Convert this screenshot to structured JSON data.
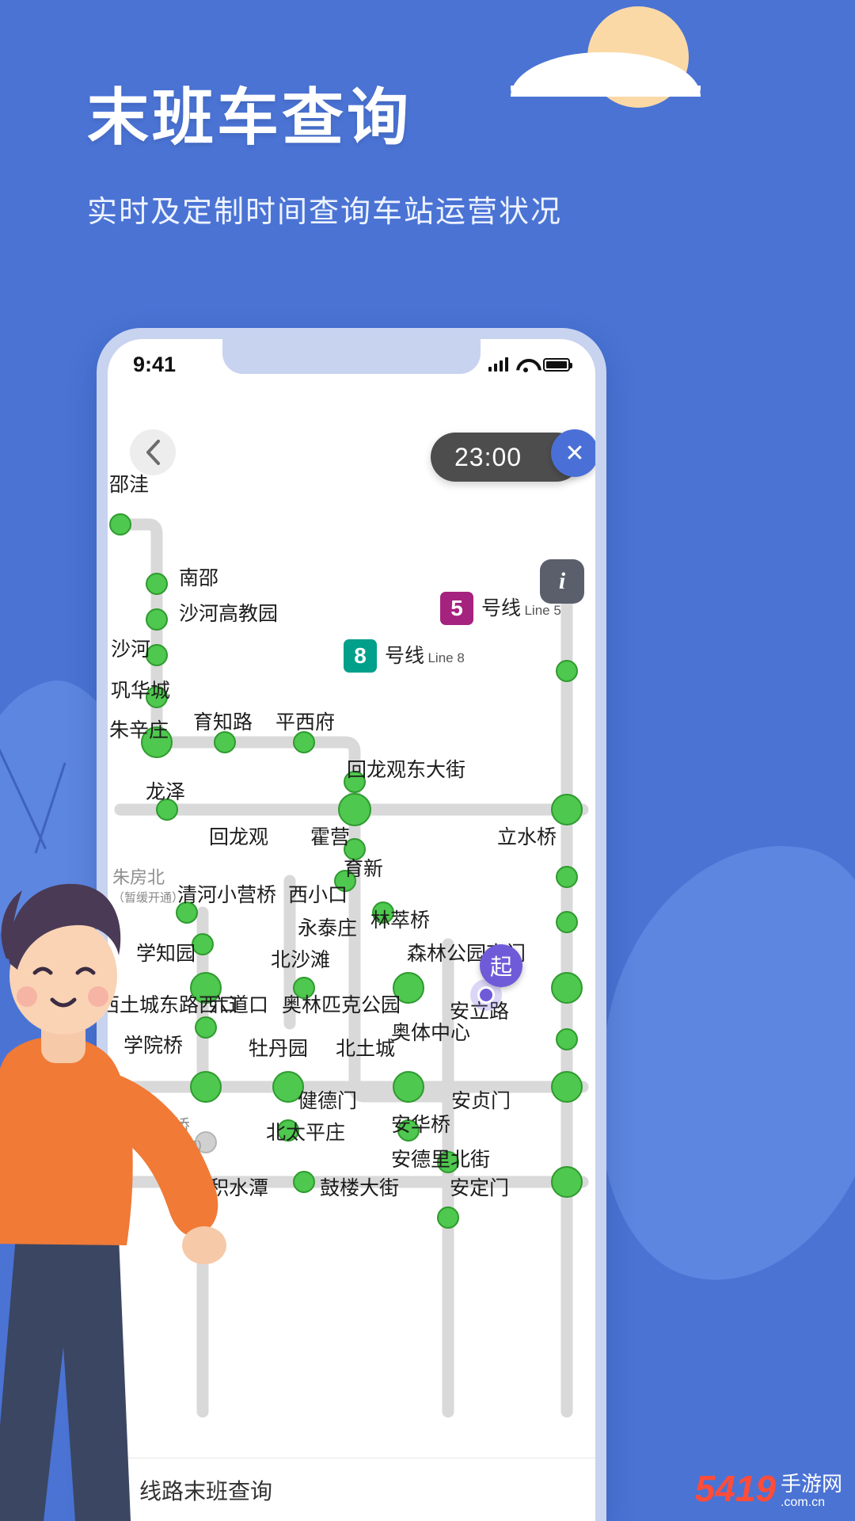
{
  "hero": {
    "title": "末班车查询",
    "subtitle": "实时及定制时间查询车站运营状况"
  },
  "colors": {
    "background": "#4a73d4",
    "accent": "#4a6fd6",
    "station": "#4ec84e",
    "line5": "#a5227f",
    "line8": "#00a08a",
    "chip": "#4d4d4d"
  },
  "phone": {
    "statusbar": {
      "time": "9:41",
      "signal_icon": "signal-bars-icon",
      "wifi_icon": "wifi-icon",
      "battery_icon": "battery-icon"
    },
    "toolbar": {
      "back_icon": "chevron-left-icon",
      "time_chip": "23:00",
      "close_icon": "✕",
      "info_icon": "i"
    },
    "line_badges": [
      {
        "number": "5",
        "cn": "号线",
        "en": "Line 5",
        "color": "#a5227f"
      },
      {
        "number": "8",
        "cn": "号线",
        "en": "Line 8",
        "color": "#00a08a"
      }
    ],
    "start_marker": {
      "label": "起"
    },
    "stations": [
      {
        "name": "邵洼",
        "note": ""
      },
      {
        "name": "南邵",
        "note": ""
      },
      {
        "name": "沙河高教园",
        "note": ""
      },
      {
        "name": "沙河",
        "note": ""
      },
      {
        "name": "巩华城",
        "note": ""
      },
      {
        "name": "朱辛庄",
        "note": ""
      },
      {
        "name": "育知路",
        "note": ""
      },
      {
        "name": "平西府",
        "note": ""
      },
      {
        "name": "回龙观东大街",
        "note": ""
      },
      {
        "name": "龙泽",
        "note": ""
      },
      {
        "name": "回龙观",
        "note": ""
      },
      {
        "name": "霍营",
        "note": ""
      },
      {
        "name": "立水桥",
        "note": ""
      },
      {
        "name": "育新",
        "note": ""
      },
      {
        "name": "朱房北",
        "note": "（暂缓开通）"
      },
      {
        "name": "清河小营桥",
        "note": ""
      },
      {
        "name": "西小口",
        "note": ""
      },
      {
        "name": "林萃桥",
        "note": ""
      },
      {
        "name": "永泰庄",
        "note": ""
      },
      {
        "name": "森林公园南门",
        "note": ""
      },
      {
        "name": "学知园",
        "note": ""
      },
      {
        "name": "北沙滩",
        "note": ""
      },
      {
        "name": "西土城东路西口",
        "note": ""
      },
      {
        "name": "六道口",
        "note": ""
      },
      {
        "name": "奥林匹克公园",
        "note": ""
      },
      {
        "name": "安立路",
        "note": ""
      },
      {
        "name": "学院桥",
        "note": ""
      },
      {
        "name": "牡丹园",
        "note": ""
      },
      {
        "name": "北土城",
        "note": ""
      },
      {
        "name": "奥体中心",
        "note": ""
      },
      {
        "name": "健德门",
        "note": ""
      },
      {
        "name": "安贞门",
        "note": ""
      },
      {
        "name": "蓟门桥",
        "note": "（暂缓开通）"
      },
      {
        "name": "北太平庄",
        "note": ""
      },
      {
        "name": "安华桥",
        "note": ""
      },
      {
        "name": "安德里北街",
        "note": ""
      },
      {
        "name": "积水潭",
        "note": ""
      },
      {
        "name": "鼓楼大街",
        "note": ""
      },
      {
        "name": "安定门",
        "note": ""
      }
    ],
    "bottom_bar": {
      "label": "线路末班查询"
    }
  },
  "watermark": {
    "number": "5419",
    "text": "手游网",
    "domain": ".com.cn"
  }
}
